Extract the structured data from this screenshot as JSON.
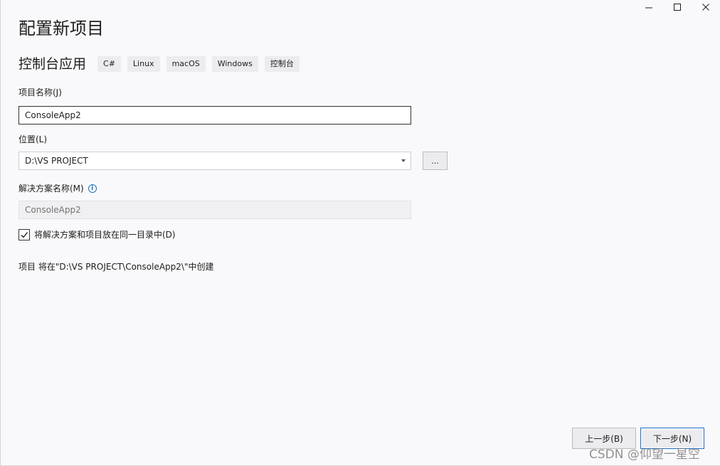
{
  "window": {
    "controls": {
      "minimize": "minimize-icon",
      "maximize": "maximize-icon",
      "close": "close-icon"
    }
  },
  "page": {
    "title": "配置新项目"
  },
  "template": {
    "name": "控制台应用",
    "tags": [
      "C#",
      "Linux",
      "macOS",
      "Windows",
      "控制台"
    ]
  },
  "form": {
    "project_name": {
      "label": "项目名称(J)",
      "value": "ConsoleApp2"
    },
    "location": {
      "label": "位置(L)",
      "value": "D:\\VS PROJECT",
      "browse_label": "..."
    },
    "solution_name": {
      "label": "解决方案名称(M)",
      "placeholder": "ConsoleApp2",
      "info_icon": "info-icon"
    },
    "same_directory": {
      "label": "将解决方案和项目放在同一目录中(D)",
      "checked": true
    }
  },
  "summary": {
    "text": "项目 将在\"D:\\VS PROJECT\\ConsoleApp2\\\"中创建"
  },
  "footer": {
    "back_label": "上一步(B)",
    "next_label": "下一步(N)"
  },
  "watermark": {
    "text": "CSDN @仰望一星空"
  },
  "colors": {
    "accent": "#1e6fc1",
    "background": "#f9f9fb",
    "tag_background": "#ececee"
  }
}
